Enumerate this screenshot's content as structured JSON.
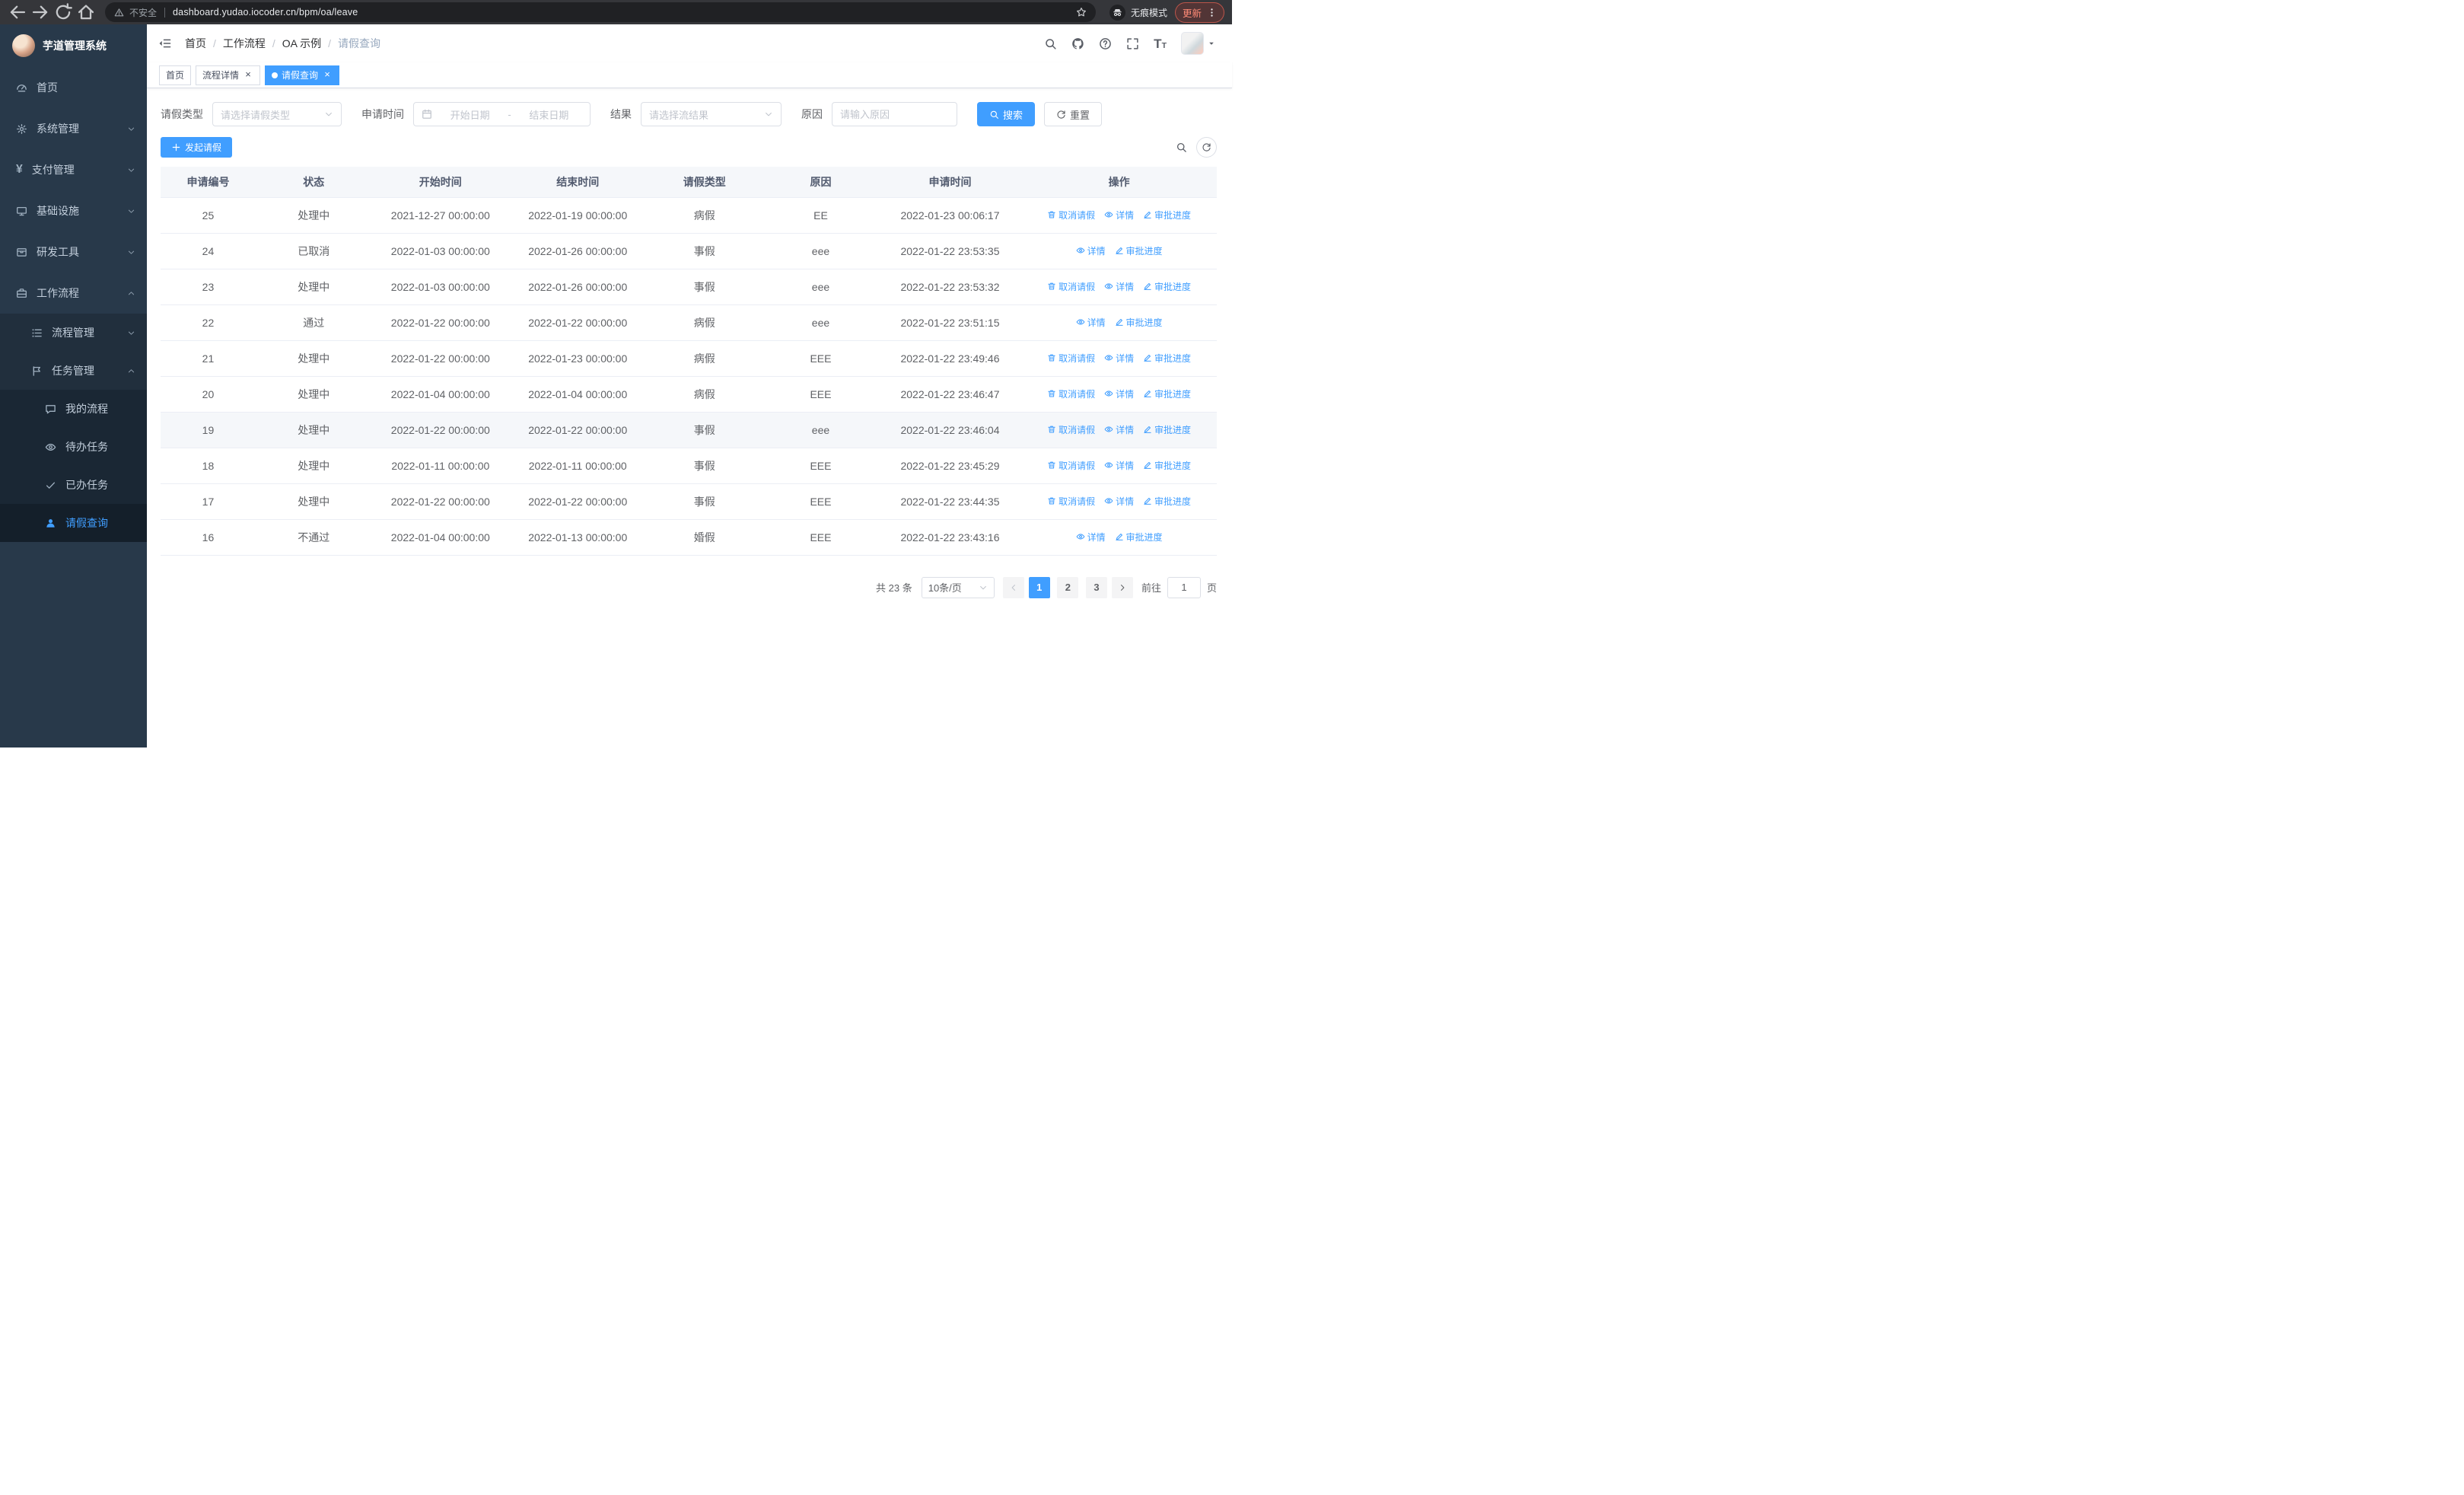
{
  "browser": {
    "security_label": "不安全",
    "url": "dashboard.yudao.iocoder.cn/bpm/oa/leave",
    "incognito_label": "无痕模式",
    "update_label": "更新"
  },
  "sidebar": {
    "app_title": "芋道管理系统",
    "menu": [
      {
        "id": "home",
        "label": "首页",
        "icon": "dashboard",
        "level": 0
      },
      {
        "id": "system-mgmt",
        "label": "系统管理",
        "icon": "gear",
        "level": 0,
        "arrow": "down"
      },
      {
        "id": "payment-mgmt",
        "label": "支付管理",
        "icon": "yen",
        "level": 0,
        "arrow": "down"
      },
      {
        "id": "infrastructure",
        "label": "基础设施",
        "icon": "monitor",
        "level": 0,
        "arrow": "down"
      },
      {
        "id": "dev-tools",
        "label": "研发工具",
        "icon": "toolbox",
        "level": 0,
        "arrow": "down"
      },
      {
        "id": "workflow",
        "label": "工作流程",
        "icon": "briefcase",
        "level": 0,
        "arrow": "up"
      },
      {
        "id": "process-mgmt",
        "label": "流程管理",
        "icon": "list",
        "level": 1,
        "arrow": "down"
      },
      {
        "id": "task-mgmt",
        "label": "任务管理",
        "icon": "flag",
        "level": 1,
        "arrow": "up"
      },
      {
        "id": "my-process",
        "label": "我的流程",
        "icon": "chat",
        "level": 2
      },
      {
        "id": "todo-task",
        "label": "待办任务",
        "icon": "eye",
        "level": 2
      },
      {
        "id": "done-task",
        "label": "已办任务",
        "icon": "check",
        "level": 2
      },
      {
        "id": "leave-query",
        "label": "请假查询",
        "icon": "user",
        "level": 2,
        "active": true
      }
    ]
  },
  "header": {
    "breadcrumb": [
      "首页",
      "工作流程",
      "OA 示例",
      "请假查询"
    ]
  },
  "tabs": [
    {
      "label": "首页",
      "closable": false,
      "active": false
    },
    {
      "label": "流程详情",
      "closable": true,
      "active": false
    },
    {
      "label": "请假查询",
      "closable": true,
      "active": true
    }
  ],
  "filters": {
    "leave_type_label": "请假类型",
    "leave_type_placeholder": "请选择请假类型",
    "apply_time_label": "申请时间",
    "start_placeholder": "开始日期",
    "separator": "-",
    "end_placeholder": "结束日期",
    "result_label": "结果",
    "result_placeholder": "请选择流结果",
    "reason_label": "原因",
    "reason_placeholder": "请输入原因",
    "search_label": "搜索",
    "reset_label": "重置"
  },
  "toolbar": {
    "create_label": "发起请假"
  },
  "table": {
    "columns": [
      "申请编号",
      "状态",
      "开始时间",
      "结束时间",
      "请假类型",
      "原因",
      "申请时间",
      "操作"
    ],
    "action_labels": {
      "cancel": "取消请假",
      "detail": "详情",
      "progress": "审批进度"
    },
    "rows": [
      {
        "id": "25",
        "status": "处理中",
        "start": "2021-12-27 00:00:00",
        "end": "2022-01-19 00:00:00",
        "type": "病假",
        "reason": "EE",
        "applied": "2022-01-23 00:06:17",
        "cancelable": true,
        "hover": false
      },
      {
        "id": "24",
        "status": "已取消",
        "start": "2022-01-03 00:00:00",
        "end": "2022-01-26 00:00:00",
        "type": "事假",
        "reason": "eee",
        "applied": "2022-01-22 23:53:35",
        "cancelable": false,
        "hover": false
      },
      {
        "id": "23",
        "status": "处理中",
        "start": "2022-01-03 00:00:00",
        "end": "2022-01-26 00:00:00",
        "type": "事假",
        "reason": "eee",
        "applied": "2022-01-22 23:53:32",
        "cancelable": true,
        "hover": false
      },
      {
        "id": "22",
        "status": "通过",
        "start": "2022-01-22 00:00:00",
        "end": "2022-01-22 00:00:00",
        "type": "病假",
        "reason": "eee",
        "applied": "2022-01-22 23:51:15",
        "cancelable": false,
        "hover": false
      },
      {
        "id": "21",
        "status": "处理中",
        "start": "2022-01-22 00:00:00",
        "end": "2022-01-23 00:00:00",
        "type": "病假",
        "reason": "EEE",
        "applied": "2022-01-22 23:49:46",
        "cancelable": true,
        "hover": false
      },
      {
        "id": "20",
        "status": "处理中",
        "start": "2022-01-04 00:00:00",
        "end": "2022-01-04 00:00:00",
        "type": "病假",
        "reason": "EEE",
        "applied": "2022-01-22 23:46:47",
        "cancelable": true,
        "hover": false
      },
      {
        "id": "19",
        "status": "处理中",
        "start": "2022-01-22 00:00:00",
        "end": "2022-01-22 00:00:00",
        "type": "事假",
        "reason": "eee",
        "applied": "2022-01-22 23:46:04",
        "cancelable": true,
        "hover": true
      },
      {
        "id": "18",
        "status": "处理中",
        "start": "2022-01-11 00:00:00",
        "end": "2022-01-11 00:00:00",
        "type": "事假",
        "reason": "EEE",
        "applied": "2022-01-22 23:45:29",
        "cancelable": true,
        "hover": false
      },
      {
        "id": "17",
        "status": "处理中",
        "start": "2022-01-22 00:00:00",
        "end": "2022-01-22 00:00:00",
        "type": "事假",
        "reason": "EEE",
        "applied": "2022-01-22 23:44:35",
        "cancelable": true,
        "hover": false
      },
      {
        "id": "16",
        "status": "不通过",
        "start": "2022-01-04 00:00:00",
        "end": "2022-01-13 00:00:00",
        "type": "婚假",
        "reason": "EEE",
        "applied": "2022-01-22 23:43:16",
        "cancelable": false,
        "hover": false
      }
    ]
  },
  "pagination": {
    "total": "共 23 条",
    "page_size": "10条/页",
    "pages": [
      "1",
      "2",
      "3"
    ],
    "active_page": "1",
    "goto_label": "前往",
    "goto_value": "1",
    "unit_label": "页"
  },
  "colors": {
    "accent": "#409eff",
    "sidebar_bg": "#28394a"
  }
}
